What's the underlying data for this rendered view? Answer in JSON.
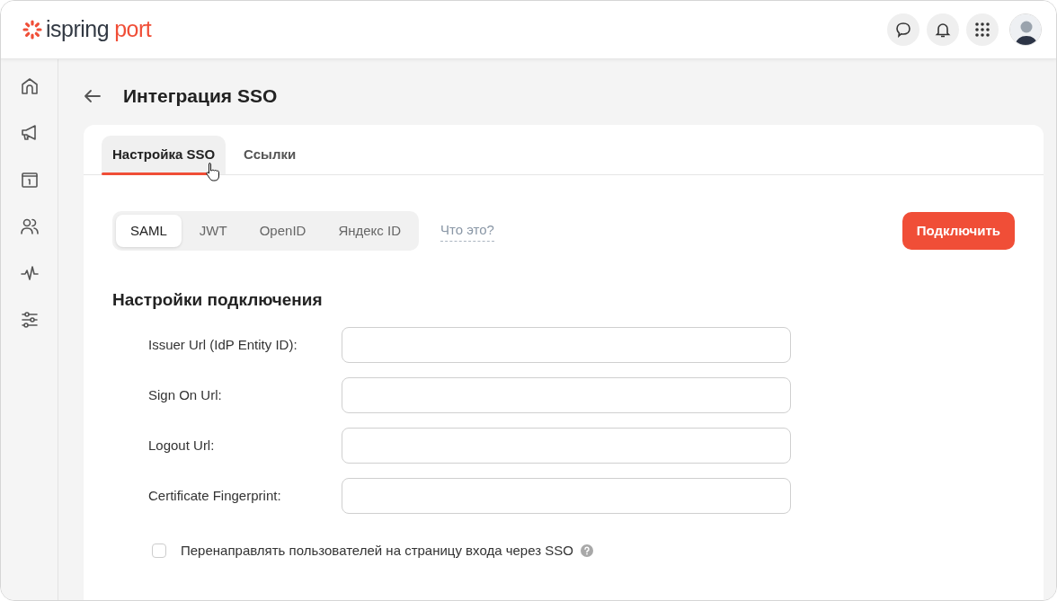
{
  "header": {
    "logo_word": "ispring",
    "logo_accent": "port"
  },
  "sidebar": {
    "items": [
      {
        "kind": "home"
      },
      {
        "kind": "megaphone"
      },
      {
        "kind": "info"
      },
      {
        "kind": "people"
      },
      {
        "kind": "pulse"
      },
      {
        "kind": "sliders"
      }
    ]
  },
  "page_title": "Интеграция SSO",
  "tabs": [
    {
      "label": "Настройка SSO",
      "selected": true
    },
    {
      "label": "Ссылки",
      "selected": false
    }
  ],
  "protocols": [
    {
      "label": "SAML",
      "selected": true
    },
    {
      "label": "JWT",
      "selected": false
    },
    {
      "label": "OpenID",
      "selected": false
    },
    {
      "label": "Яндекс ID",
      "selected": false
    }
  ],
  "help_link": "Что это?",
  "connect_button": "Подключить",
  "section_title": "Настройки подключения",
  "fields": [
    {
      "label": "Issuer Url (IdP Entity ID):"
    },
    {
      "label": "Sign On Url:"
    },
    {
      "label": "Logout Url:"
    },
    {
      "label": "Certificate Fingerprint:"
    }
  ],
  "redirect_option": {
    "label": "Перенаправлять пользователей на страницу входа через SSO",
    "checked": false
  }
}
